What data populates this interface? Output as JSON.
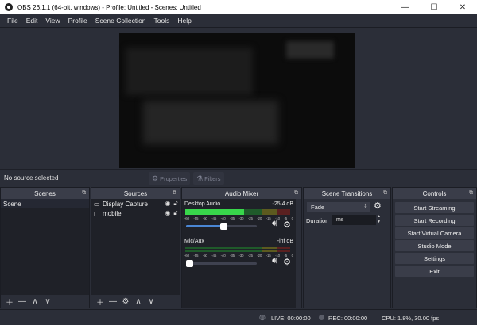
{
  "window": {
    "title": "OBS 26.1.1 (64-bit, windows) - Profile: Untitled - Scenes: Untitled",
    "minimize": "—",
    "maximize": "☐",
    "close": "✕"
  },
  "menu": [
    "File",
    "Edit",
    "View",
    "Profile",
    "Scene Collection",
    "Tools",
    "Help"
  ],
  "source_bar": {
    "status": "No source selected",
    "properties_label": "Properties",
    "filters_label": "Filters"
  },
  "scenes": {
    "header": "Scenes",
    "items": [
      "Scene"
    ]
  },
  "sources": {
    "header": "Sources",
    "items": [
      {
        "name": "Display Capture",
        "icon": "monitor-icon"
      },
      {
        "name": "mobile",
        "icon": "window-icon"
      }
    ]
  },
  "mixer": {
    "header": "Audio Mixer",
    "ticks": [
      "-60",
      "-55",
      "-50",
      "-45",
      "-40",
      "-35",
      "-30",
      "-25",
      "-20",
      "-15",
      "-10",
      "-5",
      "0"
    ],
    "channels": [
      {
        "name": "Desktop Audio",
        "db": "-25.4 dB",
        "level": 0.56,
        "volume": 0.53
      },
      {
        "name": "Mic/Aux",
        "db": "-inf dB",
        "level": 0.0,
        "volume": 0.0
      }
    ]
  },
  "transitions": {
    "header": "Scene Transitions",
    "selected": "Fade",
    "duration_label": "Duration",
    "duration_value": "ms"
  },
  "controls": {
    "header": "Controls",
    "buttons": [
      "Start Streaming",
      "Start Recording",
      "Start Virtual Camera",
      "Studio Mode",
      "Settings",
      "Exit"
    ]
  },
  "status": {
    "live": "LIVE: 00:00:00",
    "rec": "REC: 00:00:00",
    "cpu": "CPU: 1.8%, 30.00 fps"
  },
  "colors": {
    "accent": "#4a86d4",
    "meter_green": "#38d64b",
    "panel_bg": "#2b2e38",
    "list_bg": "#1f2128"
  }
}
